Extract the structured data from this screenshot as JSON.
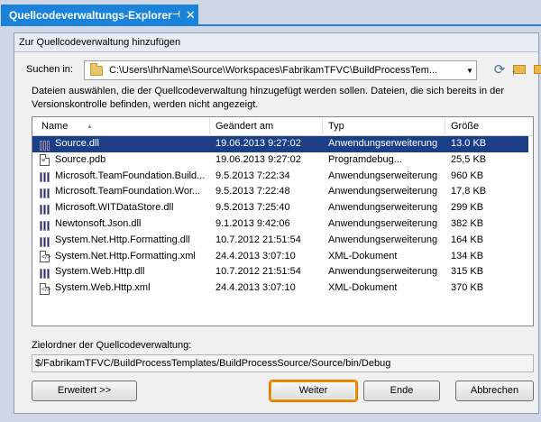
{
  "tab": {
    "title": "Quellcodeverwaltungs-Explorer",
    "pin_glyph": "⊣",
    "close_glyph": "✕",
    "color": "#1a83d9"
  },
  "dialog": {
    "title": "Zur Quellcodeverwaltung hinzufügen",
    "look_in_label": "Suchen in:",
    "look_in_path": "C:\\Users\\IhrName\\Source\\Workspaces\\FabrikamTFVC\\BuildProcessTem...",
    "instructions": "Dateien auswählen, die der Quellcodeverwaltung hinzugefügt werden sollen. Dateien, die sich bereits in der Versionskontrolle befinden, werden nicht angezeigt.",
    "columns": {
      "name": "Name",
      "date": "Geändert am",
      "type": "Typ",
      "size": "Größe"
    },
    "files": [
      {
        "name": "Source.dll",
        "date": "19.06.2013 9:27:02",
        "type": "Anwendungserweiterung",
        "size": "13.0 KB",
        "icon": "dll-icon",
        "selected": true
      },
      {
        "name": "Source.pdb",
        "date": "19.06.2013 9:27:02",
        "type": "Programdebug...",
        "size": "25,5 KB",
        "icon": "document-icon",
        "selected": false
      },
      {
        "name": "Microsoft.TeamFoundation.Build...",
        "date": "9.5.2013 7:22:34",
        "type": "Anwendungserweiterung",
        "size": "960 KB",
        "icon": "dll-icon",
        "selected": false
      },
      {
        "name": "Microsoft.TeamFoundation.Wor...",
        "date": "9.5.2013 7:22:48",
        "type": "Anwendungserweiterung",
        "size": "17,8 KB",
        "icon": "dll-icon",
        "selected": false
      },
      {
        "name": "Microsoft.WITDataStore.dll",
        "date": "9.5.2013 7:25:40",
        "type": "Anwendungserweiterung",
        "size": "299 KB",
        "icon": "dll-icon",
        "selected": false
      },
      {
        "name": "Newtonsoft.Json.dll",
        "date": "9.1.2013 9:42:06",
        "type": "Anwendungserweiterung",
        "size": "382 KB",
        "icon": "dll-icon",
        "selected": false
      },
      {
        "name": "System.Net.Http.Formatting.dll",
        "date": "10.7.2012 21:51:54",
        "type": "Anwendungserweiterung",
        "size": "164 KB",
        "icon": "dll-icon",
        "selected": false
      },
      {
        "name": "System.Net.Http.Formatting.xml",
        "date": "24.4.2013 3:07:10",
        "type": "XML-Dokument",
        "size": "134 KB",
        "icon": "xml-icon",
        "selected": false
      },
      {
        "name": "System.Web.Http.dll",
        "date": "10.7.2012 21:51:54",
        "type": "Anwendungserweiterung",
        "size": "315 KB",
        "icon": "dll-icon",
        "selected": false
      },
      {
        "name": "System.Web.Http.xml",
        "date": "24.4.2013 3:07:10",
        "type": "XML-Dokument",
        "size": "370 KB",
        "icon": "xml-icon",
        "selected": false
      }
    ],
    "destination_label": "Zielordner der Quellcodeverwaltung:",
    "destination_path": "$/FabrikamTFVC/BuildProcessTemplates/BuildProcessSource/Source/bin/Debug",
    "buttons": {
      "advanced": "Erweitert >>",
      "next": "Weiter",
      "finish": "Ende",
      "cancel": "Abbrechen"
    },
    "selection_color": "#1a3f86",
    "highlight_color": "#f08a00"
  }
}
